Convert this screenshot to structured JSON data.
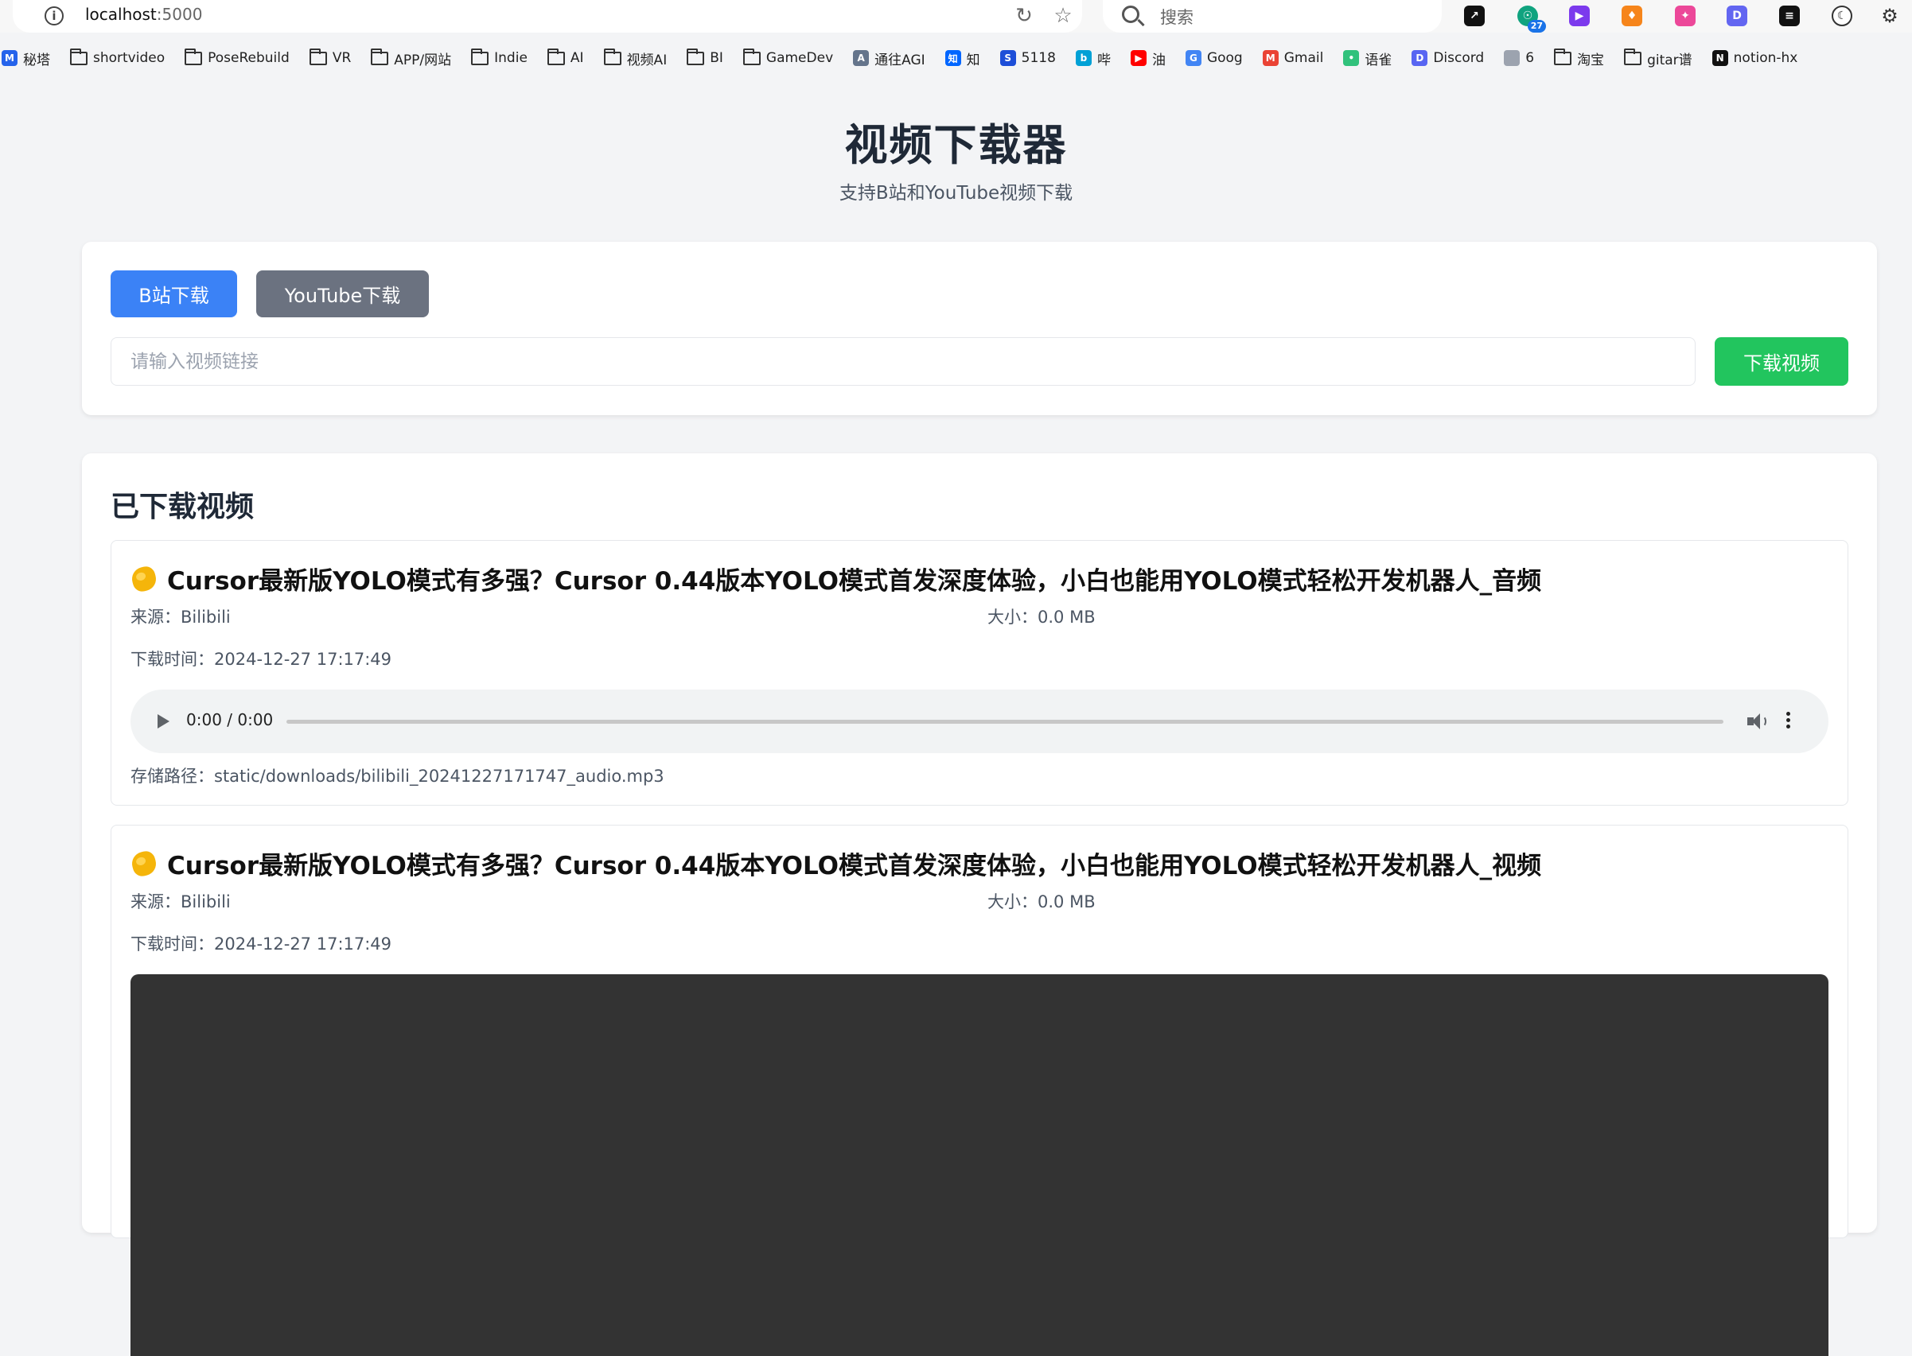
{
  "browser": {
    "url_host": "localhost",
    "url_port": ":5000",
    "search_placeholder": "搜索",
    "extension_badge": "27"
  },
  "bookmarks": [
    {
      "label": "秘塔",
      "icon": "metaso-icon",
      "type": "site"
    },
    {
      "label": "shortvideo",
      "icon": "folder-icon",
      "type": "folder"
    },
    {
      "label": "PoseRebuild",
      "icon": "folder-icon",
      "type": "folder"
    },
    {
      "label": "VR",
      "icon": "folder-icon",
      "type": "folder"
    },
    {
      "label": "APP/网站",
      "icon": "folder-icon",
      "type": "folder"
    },
    {
      "label": "Indie",
      "icon": "folder-icon",
      "type": "folder"
    },
    {
      "label": "AI",
      "icon": "folder-icon",
      "type": "folder"
    },
    {
      "label": "视频AI",
      "icon": "folder-icon",
      "type": "folder"
    },
    {
      "label": "BI",
      "icon": "folder-icon",
      "type": "folder"
    },
    {
      "label": "GameDev",
      "icon": "folder-icon",
      "type": "folder"
    },
    {
      "label": "通往AGI",
      "icon": "agi-icon",
      "type": "site"
    },
    {
      "label": "知",
      "icon": "zhihu-icon",
      "type": "site"
    },
    {
      "label": "5118",
      "icon": "5118-icon",
      "type": "site"
    },
    {
      "label": "哔",
      "icon": "bilibili-icon",
      "type": "site"
    },
    {
      "label": "油",
      "icon": "youtube-icon",
      "type": "site"
    },
    {
      "label": "Goog",
      "icon": "google-icon",
      "type": "site"
    },
    {
      "label": "Gmail",
      "icon": "gmail-icon",
      "type": "site"
    },
    {
      "label": "语雀",
      "icon": "yuque-icon",
      "type": "site"
    },
    {
      "label": "Discord",
      "icon": "discord-icon",
      "type": "site"
    },
    {
      "label": "6",
      "icon": "blurred-icon",
      "type": "site"
    },
    {
      "label": "淘宝",
      "icon": "folder-icon",
      "type": "folder"
    },
    {
      "label": "gitar谱",
      "icon": "folder-icon",
      "type": "folder"
    },
    {
      "label": "notion-hx",
      "icon": "notion-icon",
      "type": "site"
    }
  ],
  "header": {
    "title": "视频下载器",
    "subtitle": "支持B站和YouTube视频下载"
  },
  "download_form": {
    "tab_bilibili": "B站下载",
    "tab_youtube": "YouTube下载",
    "input_placeholder": "请输入视频链接",
    "input_value": "",
    "submit_label": "下载视频"
  },
  "downloads": {
    "section_title": "已下载视频",
    "items": [
      {
        "title": "Cursor最新版YOLO模式有多强？Cursor 0.44版本YOLO模式首发深度体验，小白也能用YOLO模式轻松开发机器人_音频",
        "source": "来源：Bilibili",
        "size": "大小：0.0 MB",
        "time": "下载时间：2024-12-27 17:17:49",
        "player_time": "0:00 / 0:00",
        "path": "存储路径：static/downloads/bilibili_20241227171747_audio.mp3"
      },
      {
        "title": "Cursor最新版YOLO模式有多强？Cursor 0.44版本YOLO模式首发深度体验，小白也能用YOLO模式轻松开发机器人_视频",
        "source": "来源：Bilibili",
        "size": "大小：0.0 MB",
        "time": "下载时间：2024-12-27 17:17:49"
      }
    ]
  },
  "colors": {
    "tab_active": "#3b82f6",
    "tab_inactive": "#6b7280",
    "submit": "#22c55e",
    "video_bg": "#333333",
    "page_bg": "#f3f4f6"
  }
}
